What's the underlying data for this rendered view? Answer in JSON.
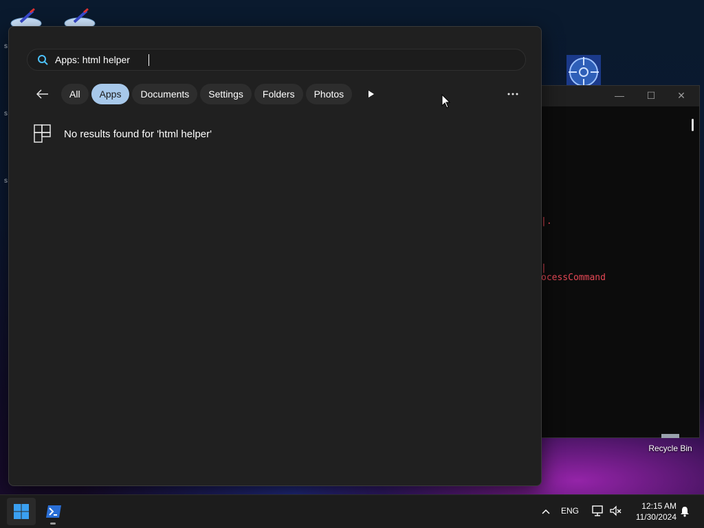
{
  "desktop": {
    "stray_glyph": "s",
    "recycle_bin_label": "Recycle Bin"
  },
  "terminal": {
    "line_1": "|.",
    "line_2": "|",
    "line_3": "ocessCommand",
    "minimize_glyph": "—",
    "maximize_glyph": "☐",
    "close_glyph": "✕"
  },
  "search": {
    "value": "Apps: html helper",
    "placeholder": ""
  },
  "filters": [
    {
      "label": "All",
      "active": false
    },
    {
      "label": "Apps",
      "active": true
    },
    {
      "label": "Documents",
      "active": false
    },
    {
      "label": "Settings",
      "active": false
    },
    {
      "label": "Folders",
      "active": false
    },
    {
      "label": "Photos",
      "active": false
    }
  ],
  "results": {
    "message": "No results found for 'html helper'"
  },
  "taskbar": {
    "language": "ENG",
    "time": "12:15 AM",
    "date": "11/30/2024"
  },
  "colors": {
    "accent": "#a7c8ea",
    "panel_bg": "#202020",
    "terminal_error": "#e74856"
  },
  "icons": {
    "search": "search-icon",
    "back": "arrow-left-icon",
    "play": "play-icon",
    "more": "more-horizontal-icon",
    "result": "apps-grid-icon",
    "start": "windows-logo-icon",
    "powershell": "powershell-icon",
    "tray_chevron": "chevron-up-icon",
    "network": "network-icon",
    "volume": "volume-muted-icon",
    "notifications": "bell-icon"
  }
}
